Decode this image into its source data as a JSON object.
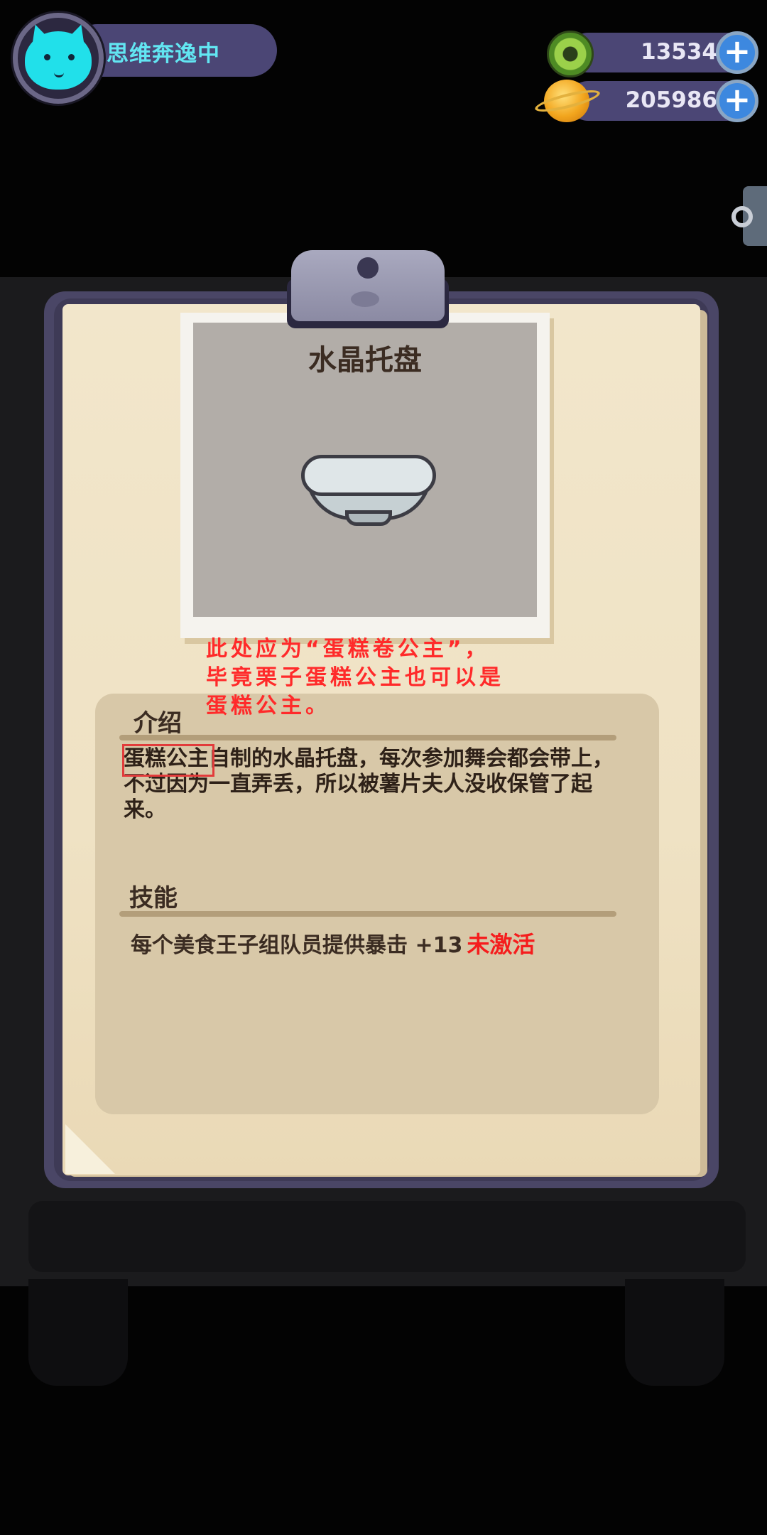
{
  "player": {
    "status": "思维奔逸中",
    "avatar": "cat-avatar-icon"
  },
  "currencies": [
    {
      "icon": "donut-coin-icon",
      "value": "13534"
    },
    {
      "icon": "planet-coin-icon",
      "value": "205986"
    }
  ],
  "item": {
    "name": "水晶托盘",
    "image": "crystal-tray-bowl-icon"
  },
  "annotation": {
    "lines": [
      "此处应为“蛋糕卷公主”，",
      "毕竟栗子蛋糕公主也可以是",
      "蛋糕公主。"
    ]
  },
  "intro": {
    "title": "介绍",
    "highlighted": "蛋糕公主",
    "text": "自制的水晶托盘，每次参加舞会都会带上，不过因为一直弄丢，所以被薯片夫人没收保管了起来。"
  },
  "skill": {
    "title": "技能",
    "text": "每个美食王子组队员提供暴击 +13",
    "status": "未激活"
  },
  "colors": {
    "inactive_status": "#f51d1d",
    "annotation": "#ff2a2a",
    "status_text": "#62e6f2"
  }
}
